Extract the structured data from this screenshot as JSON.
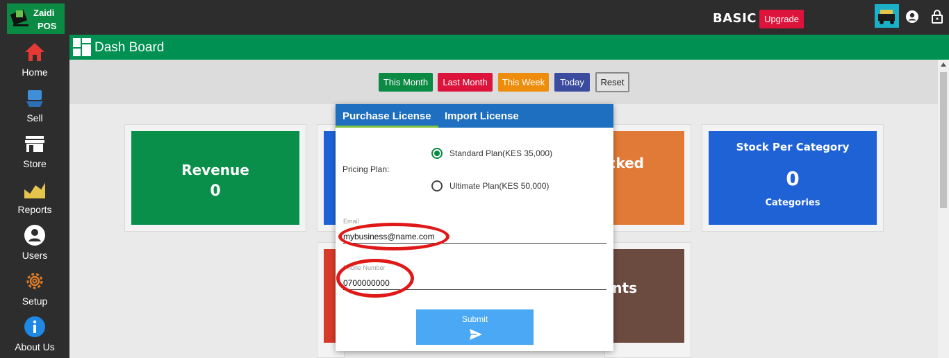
{
  "app": {
    "logo_line1": "Zaidi",
    "logo_line2": "POS",
    "plan": "BASIC",
    "upgrade_label": "Upgrade"
  },
  "sidebar": {
    "items": [
      {
        "label": "Home",
        "icon": "home-icon"
      },
      {
        "label": "Sell",
        "icon": "sell-icon"
      },
      {
        "label": "Store",
        "icon": "store-icon"
      },
      {
        "label": "Reports",
        "icon": "chart-icon"
      },
      {
        "label": "Users",
        "icon": "user-icon"
      },
      {
        "label": "Setup",
        "icon": "gear-icon"
      },
      {
        "label": "About Us",
        "icon": "info-icon"
      }
    ]
  },
  "header": {
    "title": "Dash Board"
  },
  "filters": [
    "This Month",
    "Last Month",
    "This Week",
    "Today",
    "Reset"
  ],
  "cards": {
    "revenue": {
      "title": "Revenue",
      "value": "0"
    },
    "stocked": {
      "title": "cked"
    },
    "stock_per_category": {
      "title": "Stock Per Category",
      "value": "0",
      "sub": "Categories"
    },
    "accounts": {
      "title": "nts"
    }
  },
  "modal": {
    "tabs": [
      "Purchase License",
      "Import License"
    ],
    "pricing_label": "Pricing Plan:",
    "plans": [
      "Standard Plan(KES 35,000)",
      "Ultimate Plan(KES 50,000)"
    ],
    "selected_plan": "Standard Plan(KES 35,000)",
    "email_label": "Email",
    "email_value": "mybusiness@name.com",
    "phone_label": "Phone Number",
    "phone_value": "0700000000",
    "submit_label": "Submit"
  },
  "colors": {
    "accent": "#009051",
    "tab_bar": "#1e6fbf",
    "sidebar": "#2d2d2d",
    "annotation": "#e01818"
  }
}
